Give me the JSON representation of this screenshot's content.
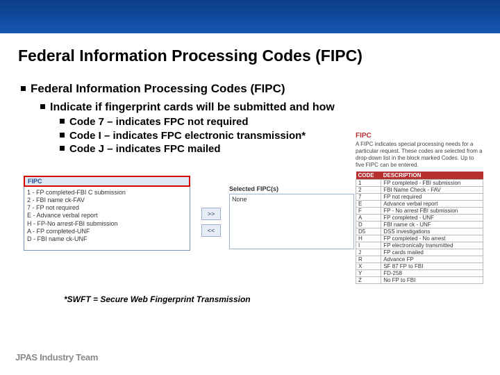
{
  "title": "Federal Information Processing Codes (FIPC)",
  "lvl1": "Federal Information Processing Codes (FIPC)",
  "lvl2": "Indicate if fingerprint cards will be submitted and how",
  "lvl3": {
    "a": "Code 7 – indicates FPC not required",
    "b": "Code I  – indicates FPC electronic transmission*",
    "c": "Code J – indicates FPC mailed"
  },
  "panel": {
    "head": "FIPC",
    "opts": [
      "1 - FP completed-FBI C submission",
      "2 - FBI name ck-FAV",
      "7 - FP not required",
      "E - Advance verbal report",
      "H - FP-No arrest-FBI submission",
      "A - FP completed-UNF",
      "D - FBI name ck-UNF"
    ]
  },
  "shuttle": {
    "add": ">>",
    "remove": "<<"
  },
  "selected": {
    "label": "Selected FIPC(s)",
    "value": "None"
  },
  "ref": {
    "title": "FIPC",
    "text": "A FIPC indicates special processing needs for a particular request. These codes are selected from a drop-down list in the block marked Codes. Up to five FIPC can be entered.",
    "cols": {
      "code": "CODE",
      "desc": "DESCRIPTION"
    },
    "rows": [
      {
        "c": "1",
        "d": "FP completed - FBI submission"
      },
      {
        "c": "2",
        "d": "FBI Name Check - FAV"
      },
      {
        "c": "7",
        "d": "FP not required"
      },
      {
        "c": "E",
        "d": "Advance verbal report"
      },
      {
        "c": "F",
        "d": "FP - No arrest FBI submission"
      },
      {
        "c": "A",
        "d": "FP completed - UNF"
      },
      {
        "c": "D",
        "d": "FBI name ck - UNF"
      },
      {
        "c": "D5",
        "d": "DSS investigations"
      },
      {
        "c": "H",
        "d": "FP completed - No arrest"
      },
      {
        "c": "I",
        "d": "FP electronically transmitted"
      },
      {
        "c": "J",
        "d": "FP cards mailed"
      },
      {
        "c": "R",
        "d": "Advance FP"
      },
      {
        "c": "X",
        "d": "SF 87 FP to FBI"
      },
      {
        "c": "Y",
        "d": "FD-258"
      },
      {
        "c": "Z",
        "d": "No FP to FBI"
      }
    ]
  },
  "footnote": "*SWFT = Secure Web Fingerprint Transmission",
  "footer": "JPAS Industry Team"
}
